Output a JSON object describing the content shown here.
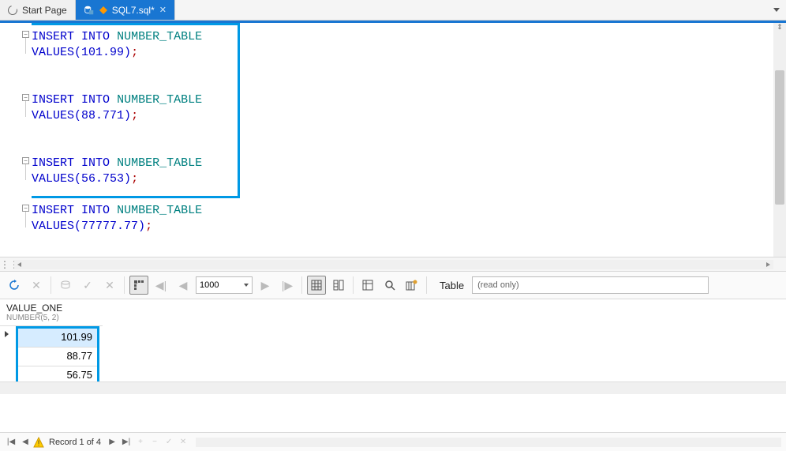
{
  "tabs": {
    "startPage": "Start Page",
    "activeFile": "SQL7.sql*"
  },
  "code": {
    "stmt1": {
      "kw1": "INSERT",
      "kw2": "INTO",
      "tbl": "NUMBER_TABLE",
      "vals": "VALUES",
      "lp": "(",
      "num": "101.99",
      "rp": ")",
      "semi": ";"
    },
    "stmt2": {
      "kw1": "INSERT",
      "kw2": "INTO",
      "tbl": "NUMBER_TABLE",
      "vals": "VALUES",
      "lp": "(",
      "num": "88.771",
      "rp": ")",
      "semi": ";"
    },
    "stmt3": {
      "kw1": "INSERT",
      "kw2": "INTO",
      "tbl": "NUMBER_TABLE",
      "vals": "VALUES",
      "lp": "(",
      "num": "56.753",
      "rp": ")",
      "semi": ";"
    },
    "stmt4": {
      "kw1": "INSERT",
      "kw2": "INTO",
      "tbl": "NUMBER_TABLE",
      "vals": "VALUES",
      "lp": "(",
      "num": "77777.77",
      "rp": ")",
      "semi": ";"
    }
  },
  "toolbar": {
    "fetchSize": "1000",
    "viewLabel": "Table",
    "readOnly": "(read only)"
  },
  "results": {
    "column": {
      "name": "VALUE_ONE",
      "type": "NUMBER(5, 2)"
    },
    "rows": [
      "101.99",
      "88.77",
      "56.75"
    ]
  },
  "status": {
    "recordText": "Record 1 of 4"
  }
}
